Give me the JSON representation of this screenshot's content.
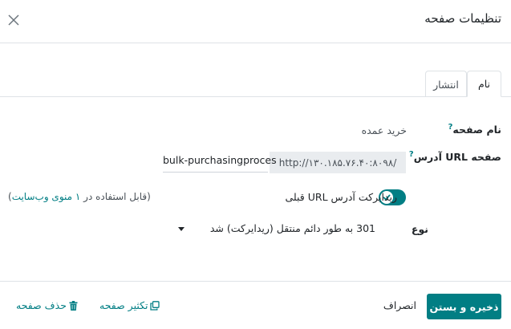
{
  "dialog": {
    "title": "تنظیمات صفحه"
  },
  "tabs": [
    {
      "label": "نام",
      "active": true
    },
    {
      "label": "انتشار",
      "active": false
    }
  ],
  "form": {
    "page_name_label": "نام صفحه",
    "page_name_value": "خرید عمده",
    "page_url_label": "آدرس URL صفحه",
    "url_prefix": "http://۱۳۰.۱۸۵.۷۶.۴۰:۸۰۹۸/",
    "url_slug": "bulk-purchasingproces",
    "redirect_toggle_label": "ریدایرکت آدرس URL قبلی",
    "redirect_enabled": true,
    "menu_note_before": "(قابل استفاده در ",
    "menu_note_link": "۱ منوی وب‌سایت",
    "menu_note_after": ")",
    "type_label": "نوع",
    "type_value": "301 به طور دائم منتقل (ریدایرکت) شد",
    "help_mark": "?"
  },
  "footer": {
    "save_label": "ذخیره و بستن",
    "discard_label": "انصراف",
    "duplicate_label": "تکثیر صفحه",
    "delete_label": "حذف صفحه"
  },
  "colors": {
    "primary": "#017e84",
    "border": "#dee2e6",
    "readonly_bg": "#e9ecef"
  },
  "icons": {
    "close": "close-icon",
    "duplicate": "copy-icon",
    "delete": "trash-icon",
    "toggle_check": "check-icon",
    "dropdown": "caret-down-icon"
  }
}
